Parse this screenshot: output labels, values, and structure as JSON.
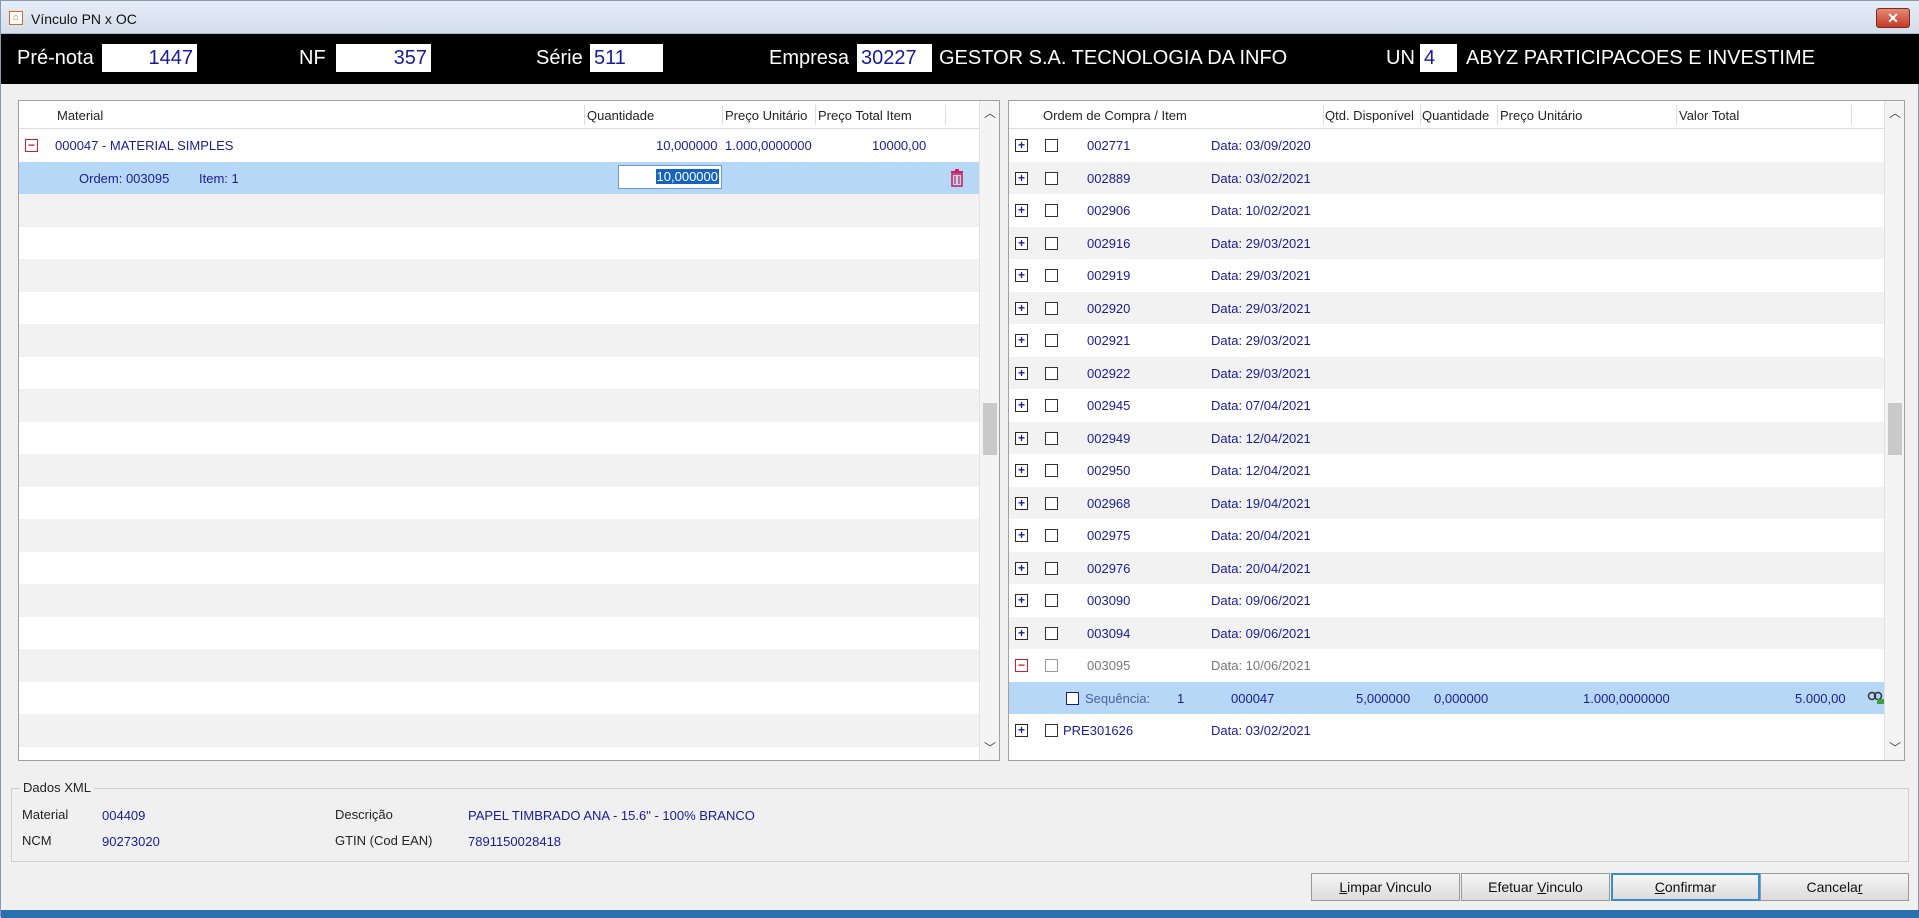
{
  "window": {
    "title": "Vínculo PN x OC",
    "icon": "app-icon",
    "close": "✕"
  },
  "header": {
    "prenota_label": "Pré-nota",
    "prenota_value": "1447",
    "nf_label": "NF",
    "nf_value": "357",
    "serie_label": "Série",
    "serie_value": "511",
    "empresa_label": "Empresa",
    "empresa_value": "30227",
    "empresa_name": "GESTOR S.A. TECNOLOGIA DA INFO",
    "un_label": "UN",
    "un_value": "4",
    "un_name": "ABYZ PARTICIPACOES E INVESTIME"
  },
  "left_grid": {
    "columns": [
      "Material",
      "Quantidade",
      "Preço Unitário",
      "Preço Total Item"
    ],
    "material_row": {
      "material": "000047 - MATERIAL SIMPLES",
      "quantidade": "10,000000",
      "preco_unitario": "1.000,0000000",
      "preco_total": "10000,00"
    },
    "order_row": {
      "ordem": "Ordem: 003095",
      "item": "Item: 1",
      "quantidade": "10,000000"
    }
  },
  "right_grid": {
    "columns": [
      "Ordem de Compra / Item",
      "Qtd. Disponível",
      "Quantidade",
      "Preço Unitário",
      "Valor Total"
    ],
    "orders": [
      {
        "number": "002771",
        "date": "Data: 03/09/2020"
      },
      {
        "number": "002889",
        "date": "Data: 03/02/2021"
      },
      {
        "number": "002906",
        "date": "Data: 10/02/2021"
      },
      {
        "number": "002916",
        "date": "Data: 29/03/2021"
      },
      {
        "number": "002919",
        "date": "Data: 29/03/2021"
      },
      {
        "number": "002920",
        "date": "Data: 29/03/2021"
      },
      {
        "number": "002921",
        "date": "Data: 29/03/2021"
      },
      {
        "number": "002922",
        "date": "Data: 29/03/2021"
      },
      {
        "number": "002945",
        "date": "Data: 07/04/2021"
      },
      {
        "number": "002949",
        "date": "Data: 12/04/2021"
      },
      {
        "number": "002950",
        "date": "Data: 12/04/2021"
      },
      {
        "number": "002968",
        "date": "Data: 19/04/2021"
      },
      {
        "number": "002975",
        "date": "Data: 20/04/2021"
      },
      {
        "number": "002976",
        "date": "Data: 20/04/2021"
      },
      {
        "number": "003090",
        "date": "Data: 09/06/2021"
      },
      {
        "number": "003094",
        "date": "Data: 09/06/2021"
      },
      {
        "number": "003095",
        "date": "Data: 10/06/2021"
      }
    ],
    "sequence_row": {
      "label": "Sequência:",
      "seq": "1",
      "material": "000047",
      "qtd_disponivel": "5,000000",
      "quantidade": "0,000000",
      "preco_unitario": "1.000,0000000",
      "valor_total": "5.000,00"
    },
    "last_order": {
      "number": "PRE301626",
      "date": "Data: 03/02/2021"
    }
  },
  "xml_data": {
    "legend": "Dados XML",
    "material_label": "Material",
    "material_value": "004409",
    "ncm_label": "NCM",
    "ncm_value": "90273020",
    "descricao_label": "Descrição",
    "descricao_value": "PAPEL TIMBRADO ANA - 15.6\" - 100% BRANCO",
    "gtin_label": "GTIN (Cod EAN)",
    "gtin_value": "7891150028418"
  },
  "buttons": {
    "limpar_pre": "",
    "limpar_u": "L",
    "limpar_post": "impar Vinculo",
    "efetuar_pre": "Efetuar ",
    "efetuar_u": "V",
    "efetuar_post": "inculo",
    "confirmar_pre": "",
    "confirmar_u": "C",
    "confirmar_post": "onfirmar",
    "cancelar_pre": "Cancela",
    "cancelar_u": "r",
    "cancelar_post": ""
  },
  "colors": {
    "accent": "#1b1b9a",
    "selection": "#b6d7f6",
    "header_bg": "#000000",
    "delete": "#d02060"
  }
}
